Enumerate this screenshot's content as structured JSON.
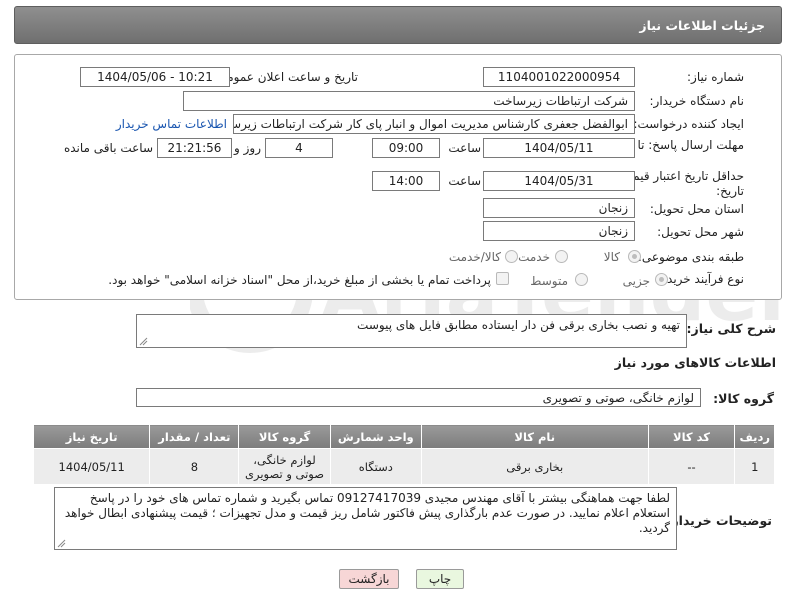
{
  "header": {
    "title": "جزئیات اطلاعات نیاز"
  },
  "fields": {
    "need_number": {
      "label": "شماره نیاز:",
      "value": "1104001022000954"
    },
    "announce_datetime": {
      "label": "تاریخ و ساعت اعلان عمومی:",
      "value": "1404/05/06 - 10:21"
    },
    "buyer_org": {
      "label": "نام دستگاه خریدار:",
      "value": "شرکت ارتباطات زیرساخت"
    },
    "requester": {
      "label": "ایجاد کننده درخواست:",
      "value": "ابوالفضل جعفری کارشناس مدیریت اموال و انبار پای کار  شرکت ارتباطات زیرساخت",
      "contact_link": "اطلاعات تماس خریدار"
    },
    "reply_deadline": {
      "label": "مهلت ارسال پاسخ: تا تاریخ:",
      "date": "1404/05/11",
      "time_label": "ساعت",
      "time": "09:00",
      "days": "4",
      "days_label": "روز و",
      "remaining": "21:21:56",
      "remaining_label": "ساعت باقی مانده"
    },
    "price_validity": {
      "label": "حداقل تاریخ اعتبار قیمت: تا تاریخ:",
      "date": "1404/05/31",
      "time_label": "ساعت",
      "time": "14:00"
    },
    "delivery_province": {
      "label": "استان محل تحویل:",
      "value": "زنجان"
    },
    "delivery_city": {
      "label": "شهر محل تحویل:",
      "value": "زنجان"
    },
    "category": {
      "label": "طبقه بندی موضوعی:",
      "options": [
        "کالا",
        "خدمت",
        "کالا/خدمت"
      ],
      "selected": "کالا"
    },
    "process_type": {
      "label": "نوع فرآیند خرید :",
      "options": [
        "جزیی",
        "متوسط"
      ],
      "selected": "جزیی",
      "note": "پرداخت تمام یا بخشی از مبلغ خرید،از محل \"اسناد خزانه اسلامی\" خواهد بود."
    }
  },
  "description": {
    "label": "شرح کلی نیاز:",
    "value": "تهیه و نصب بخاری برقی فن دار ایستاده مطابق فایل های پیوست"
  },
  "goods": {
    "section_title": "اطلاعات کالاهای مورد نیاز",
    "group_label": "گروه کالا:",
    "group_value": "لوازم خانگی، صوتی و تصویری",
    "columns": [
      "ردیف",
      "کد کالا",
      "نام کالا",
      "واحد شمارش",
      "گروه کالا",
      "تعداد / مقدار",
      "تاریخ نیاز"
    ],
    "rows": [
      {
        "row": "1",
        "code": "--",
        "name": "بخاری برقی",
        "unit": "دستگاه",
        "group": "لوازم خانگی، صوتی و تصویری",
        "qty": "8",
        "date": "1404/05/11"
      }
    ]
  },
  "buyer_notes": {
    "label": "توضیحات خریدار:",
    "value": "لطفا جهت هماهنگی بیشتر با آقای مهندس مجیدی 09127417039 تماس بگیرید و شماره تماس های خود را در پاسخ استعلام اعلام نمایید. در صورت عدم بارگذاری پیش فاکتور شامل ریز قیمت و مدل تجهیزات ؛ قیمت پیشنهادی ابطال خواهد گردید."
  },
  "buttons": {
    "print": "چاپ",
    "back": "بازگشت"
  },
  "watermark": {
    "text": "AriaTender.net"
  },
  "colors": {
    "header": "#7c7c7c",
    "back_button": "#f7d6d6",
    "print_button": "#e9f7df",
    "link": "#1a56b0"
  }
}
